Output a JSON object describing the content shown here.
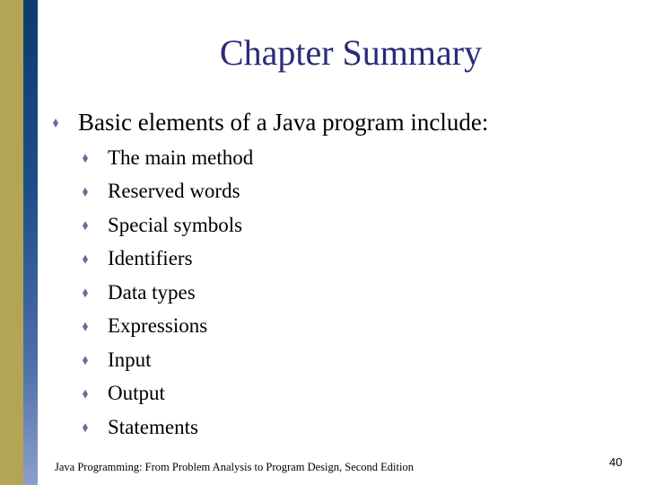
{
  "slide": {
    "title": "Chapter Summary",
    "colors": {
      "left_bar_gold": "#b3a553",
      "left_bar_blue_top": "#0d3b6e",
      "left_bar_blue_bottom": "#8d9fcc",
      "title_color": "#2b2b78",
      "bullet_color": "#6a6a9a"
    },
    "bullet_icon": "diamond-bullet-icon",
    "main_bullet": "Basic elements of a Java program include:",
    "sub_bullets": [
      "The main method",
      "Reserved words",
      "Special symbols",
      "Identifiers",
      "Data types",
      "Expressions",
      "Input",
      "Output",
      "Statements"
    ],
    "footer": "Java Programming: From Problem Analysis to Program Design, Second Edition",
    "page_number": "40"
  }
}
